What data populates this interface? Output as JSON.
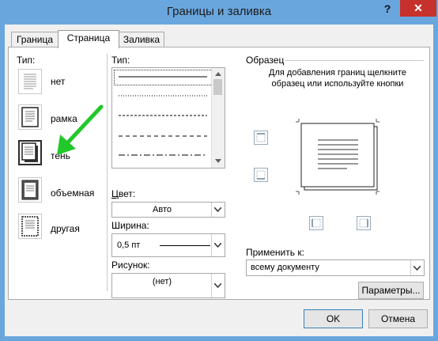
{
  "window": {
    "title": "Границы и заливка",
    "help_label": "?",
    "close_label": "✕"
  },
  "tabs": [
    {
      "label": "Граница",
      "active": false
    },
    {
      "label": "Страница",
      "active": true
    },
    {
      "label": "Заливка",
      "active": false
    }
  ],
  "setting": {
    "label": "Тип:",
    "items": [
      {
        "label": "нет",
        "selected": false
      },
      {
        "label": "рамка",
        "selected": false
      },
      {
        "label": "тень",
        "selected": true
      },
      {
        "label": "объемная",
        "selected": false
      },
      {
        "label": "другая",
        "selected": false
      }
    ]
  },
  "style": {
    "label": "Тип:",
    "lines": [
      "solid",
      "dotted",
      "dashed-fine",
      "dashed",
      "dash-dot"
    ],
    "selected_index": 0
  },
  "color": {
    "label": "Цвет:",
    "value": "Авто"
  },
  "width": {
    "label": "Ширина:",
    "value": "0,5 пт"
  },
  "art": {
    "label": "Рисунок:",
    "value": "(нет)"
  },
  "preview": {
    "label": "Образец",
    "hint": "Для добавления границ щелкните образец или используйте кнопки"
  },
  "apply_to": {
    "label": "Применить к:",
    "value": "всему документу"
  },
  "buttons": {
    "options": "Параметры...",
    "ok": "OK",
    "cancel": "Отмена"
  },
  "colors": {
    "accent": "#3c7fb1",
    "titlebar": "#6aa6de",
    "close": "#c7312b",
    "arrow": "#22c82a"
  }
}
